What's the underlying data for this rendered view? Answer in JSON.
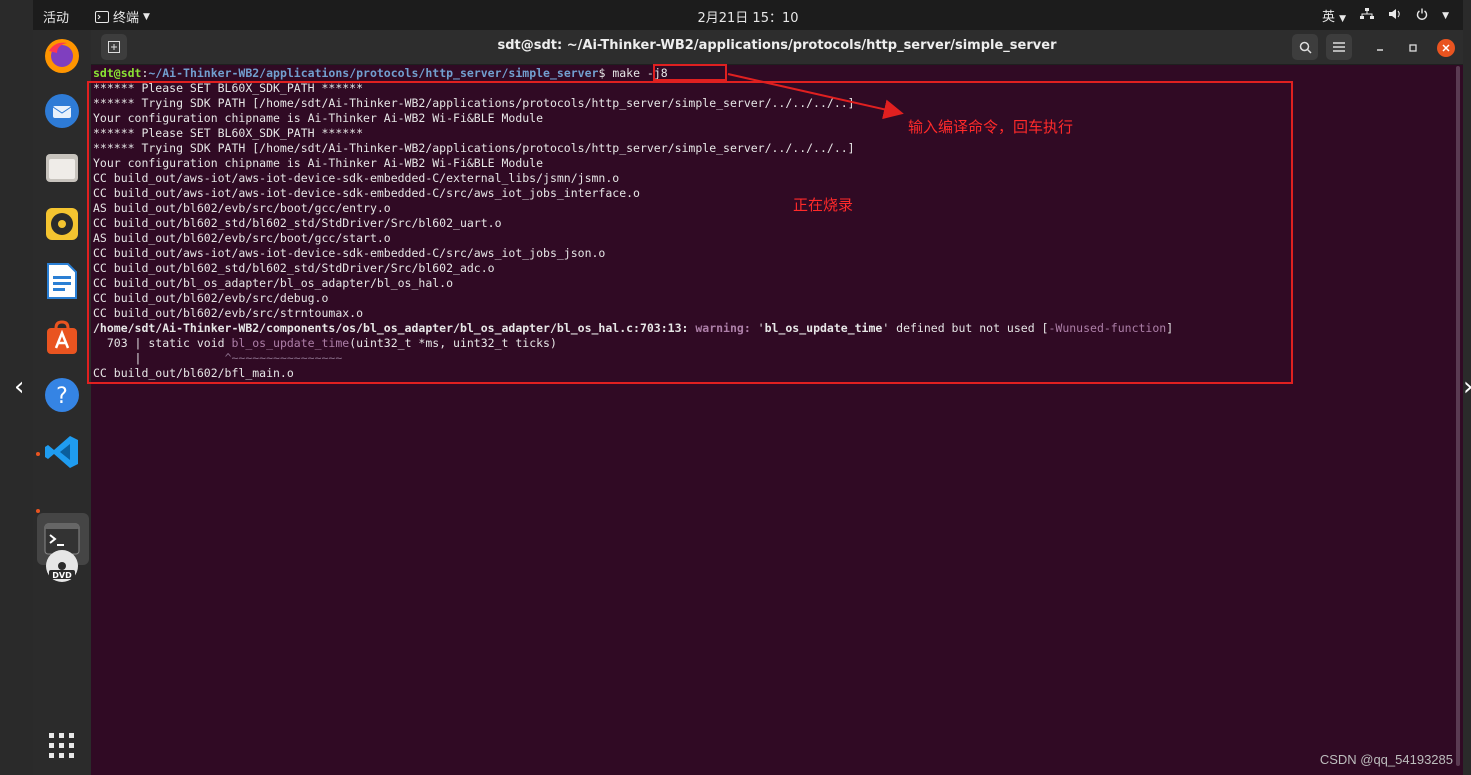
{
  "topbar": {
    "activities": "活动",
    "app_menu": "终端",
    "clock": "2月21日  15：10",
    "input_method": "英"
  },
  "dock": {
    "items": [
      {
        "name": "firefox-icon",
        "color": "#ff7139"
      },
      {
        "name": "thunderbird-icon",
        "color": "#2e7bd6"
      },
      {
        "name": "files-icon",
        "color": "#c7c3bd"
      },
      {
        "name": "rhythmbox-icon",
        "color": "#f4c430"
      },
      {
        "name": "libreoffice-writer-icon",
        "color": "#2a7fd4"
      },
      {
        "name": "ubuntu-software-icon",
        "color": "#e95420"
      },
      {
        "name": "help-icon",
        "color": "#3584e4"
      },
      {
        "name": "vscode-icon",
        "color": "#1f9cf0"
      },
      {
        "name": "terminal-icon",
        "color": "#333333"
      },
      {
        "name": "dvd-icon",
        "color": "#e6e6e6"
      }
    ],
    "show_apps_icon": "app-grid-icon"
  },
  "window": {
    "title": "sdt@sdt: ~/Ai-Thinker-WB2/applications/protocols/http_server/simple_server"
  },
  "terminal": {
    "prompt_user": "sdt@sdt",
    "prompt_sep": ":",
    "prompt_path": "~/Ai-Thinker-WB2/applications/protocols/http_server/simple_server",
    "prompt_dollar": "$",
    "command": " make -j8",
    "output": [
      "****** Please SET BL60X_SDK_PATH ******",
      "****** Trying SDK PATH [/home/sdt/Ai-Thinker-WB2/applications/protocols/http_server/simple_server/../../../..]",
      "Your configuration chipname is Ai-Thinker Ai-WB2 Wi-Fi&BLE Module",
      "****** Please SET BL60X_SDK_PATH ******",
      "****** Trying SDK PATH [/home/sdt/Ai-Thinker-WB2/applications/protocols/http_server/simple_server/../../../..]",
      "Your configuration chipname is Ai-Thinker Ai-WB2 Wi-Fi&BLE Module",
      "CC build_out/aws-iot/aws-iot-device-sdk-embedded-C/external_libs/jsmn/jsmn.o",
      "CC build_out/aws-iot/aws-iot-device-sdk-embedded-C/src/aws_iot_jobs_interface.o",
      "AS build_out/bl602/evb/src/boot/gcc/entry.o",
      "CC build_out/bl602_std/bl602_std/StdDriver/Src/bl602_uart.o",
      "AS build_out/bl602/evb/src/boot/gcc/start.o",
      "CC build_out/aws-iot/aws-iot-device-sdk-embedded-C/src/aws_iot_jobs_json.o",
      "CC build_out/bl602_std/bl602_std/StdDriver/Src/bl602_adc.o",
      "CC build_out/bl_os_adapter/bl_os_adapter/bl_os_hal.o",
      "CC build_out/bl602/evb/src/debug.o",
      "CC build_out/bl602/evb/src/strntoumax.o"
    ],
    "warning": {
      "location": "/home/sdt/Ai-Thinker-WB2/components/os/bl_os_adapter/bl_os_adapter/bl_os_hal.c:703:13:",
      "label": " warning:",
      "message_pre": " '",
      "symbol": "bl_os_update_time",
      "message_post": "' defined but not used [",
      "flag": "-Wunused-function",
      "flag_close": "]",
      "src_prefix": "  703 | static void ",
      "src_func": "bl_os_update_time",
      "src_rest": "(uint32_t *ms, uint32_t ticks)",
      "gutter": "      |            ",
      "caret": "^~~~~~~~~~~~~~~~~"
    },
    "last_line": "CC build_out/bl602/bfl_main.o"
  },
  "annotations": {
    "command_note": "输入编译命令，回车执行",
    "progress_note": "正在烧录",
    "color": "#ff2a2a"
  },
  "watermark": "CSDN @qq_54193285"
}
